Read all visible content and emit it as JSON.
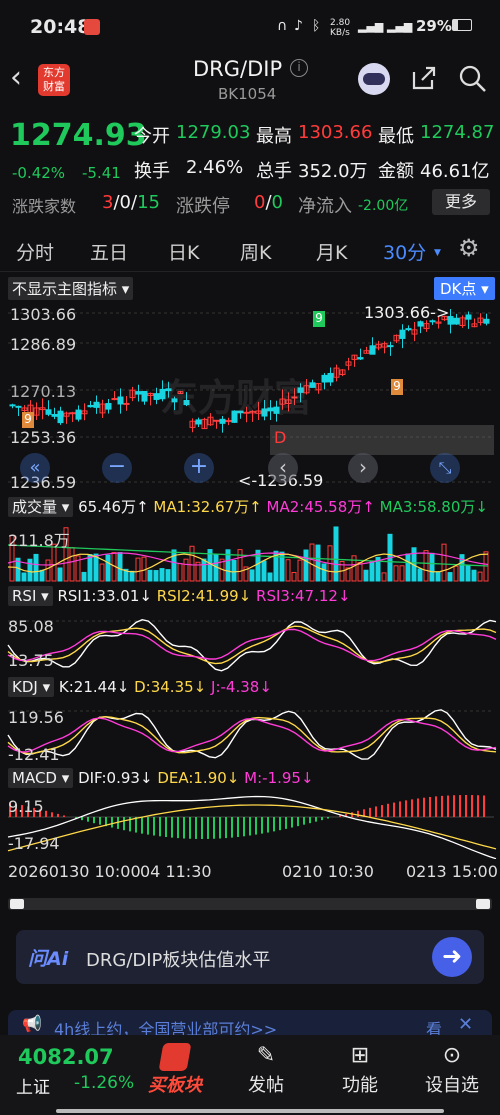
{
  "status_bar": {
    "time": "20:48",
    "speed": "2.80 KB/s",
    "battery": "29%"
  },
  "header": {
    "brand_line1": "东方",
    "brand_line2": "财富",
    "title": "DRG/DIP",
    "info_icon": "info-icon",
    "code": "BK1054"
  },
  "quote": {
    "price": "1274.93",
    "change_pct": "-0.42%",
    "change_val": "-5.41",
    "open_label": "今开",
    "open_val": "1279.03",
    "high_label": "最高",
    "high_val": "1303.66",
    "low_label": "最低",
    "low_val": "1274.87",
    "turnover_label": "换手",
    "turnover_val": "2.46%",
    "volume_label": "总手",
    "volume_val": "352.0万",
    "amount_label": "金额",
    "amount_val": "46.61亿",
    "updown_label": "涨跌家数",
    "up_count": "3",
    "sep1": "/",
    "flat_count": "0",
    "sep2": "/",
    "down_count": "15",
    "limit_label": "涨跌停",
    "limit_up": "0",
    "sep3": "/",
    "limit_down": "0",
    "netflow_label": "净流入",
    "netflow_val": "-2.00亿",
    "more_label": "更多"
  },
  "tabs": [
    "分时",
    "五日",
    "日K",
    "周K",
    "月K",
    "30分"
  ],
  "main_chart": {
    "indicator_select": "不显示主图指标",
    "dk_button": "DK点",
    "y_ticks": [
      "1303.66",
      "1286.89",
      "1270.13",
      "1253.36",
      "1236.59"
    ],
    "high_label": "1303.66->",
    "low_label": "<-1236.59",
    "signal_d": "D",
    "signal_9": "9",
    "watermark": "东方财富"
  },
  "volume": {
    "label": "成交量",
    "vol": "65.46万",
    "ma1": "MA1:32.67万",
    "ma2": "MA2:45.58万",
    "ma3": "MA3:58.80万",
    "top": "211.8万"
  },
  "rsi": {
    "label": "RSI",
    "r1": "RSI1:33.01",
    "r2": "RSI2:41.99",
    "r3": "RSI3:47.12",
    "top": "85.08",
    "bottom": "13.75"
  },
  "kdj": {
    "label": "KDJ",
    "k": "K:21.44",
    "d": "D:34.35",
    "j": "J:-4.38",
    "top": "119.56",
    "bottom": "-12.41"
  },
  "macd": {
    "label": "MACD",
    "dif": "DIF:0.93",
    "dea": "DEA:1.90",
    "m": "M:-1.95",
    "top": "9.15",
    "bottom": "-17.94"
  },
  "time_axis": [
    "20260130 10:00",
    "04 11:30",
    "0210 10:30",
    "0213 15:00"
  ],
  "ask_bar": {
    "logo": "问Ai",
    "text": "DRG/DIP板块估值水平"
  },
  "ticker": {
    "text": "4h线上约，全国营业部可约>>",
    "right": "看"
  },
  "bottom_nav": {
    "index_val": "4082.07",
    "index_name": "上证",
    "index_pct": "-1.26%",
    "items": [
      "买板块",
      "发帖",
      "功能",
      "设自选"
    ]
  },
  "colors": {
    "up": "#ff3b3b",
    "down": "#1fc95c",
    "accent": "#3d7cff"
  }
}
